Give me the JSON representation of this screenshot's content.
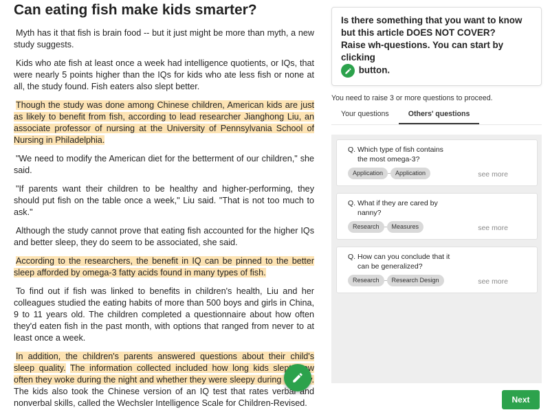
{
  "article": {
    "title": "Can eating fish make kids smarter?",
    "paragraphs": [
      {
        "segments": [
          {
            "text": "Myth has it that fish is brain food -- but it just might be more than myth, a new study suggests.",
            "hl": false
          }
        ]
      },
      {
        "segments": [
          {
            "text": "Kids who ate fish at least once a week had intelligence quotients, or IQs, that were nearly 5 points higher than the IQs for kids who ate less fish or none at all, the study found. Fish eaters also slept better.",
            "hl": false
          }
        ]
      },
      {
        "segments": [
          {
            "text": "Though the study was done among Chinese children, American kids are just as likely to benefit from fish, according to lead researcher Jianghong Liu, an associate professor of nursing at the University of Pennsylvania School of Nursing in Philadelphia.",
            "hl": true
          }
        ]
      },
      {
        "segments": [
          {
            "text": "\"We need to modify the American diet for the betterment of our children,\" she said.",
            "hl": false
          }
        ]
      },
      {
        "segments": [
          {
            "text": "\"If parents want their children to be healthy and higher-performing, they should put fish on the table once a week,\" Liu said.  \"That is not too much to ask.\"",
            "hl": false
          }
        ]
      },
      {
        "segments": [
          {
            "text": "Although the study cannot prove that eating fish accounted for the higher IQs and better sleep, they do seem to be associated, she said.",
            "hl": false
          }
        ]
      },
      {
        "segments": [
          {
            "text": "According to the researchers, the benefit in IQ can be pinned to the better sleep afforded by omega-3 fatty acids found in many types of fish.",
            "hl": true
          }
        ]
      },
      {
        "segments": [
          {
            "text": "To find out if fish was linked to benefits in children's health, Liu and her colleagues studied the eating habits of more than 500 boys and girls in China, 9 to 11 years old.  The children completed a questionnaire about how often they'd eaten fish in the past month, with options that ranged from never to at least once a week.",
            "hl": false
          }
        ]
      },
      {
        "segments": [
          {
            "text": "In addition, the children's parents answered questions about their child's sleep quality.",
            "hl": true
          },
          {
            "text": " ",
            "hl": false
          },
          {
            "text": "The information collected included how long kids slept, how often they woke during the night and whether they were sleepy during the day.",
            "hl": true
          },
          {
            "text": " The kids also took the Chinese version of an IQ test that rates verbal and nonverbal skills, called the Wechsler Intelligence Scale for Children-Revised.",
            "hl": false
          }
        ]
      }
    ]
  },
  "prompt": {
    "line1": "Is there something that you want to know but this article DOES NOT COVER?",
    "line2": "Raise wh-questions. You can start by clicking",
    "line3": "button."
  },
  "requirement": "You need to raise 3 or more questions to proceed.",
  "tabs": [
    "Your questions",
    "Others' questions"
  ],
  "active_tab": 1,
  "questions": [
    {
      "prefix": "Q.",
      "line1": "Which type of fish contains",
      "line2": "the most omega-3?",
      "tags": [
        "Application",
        "Application"
      ],
      "see_more": "see more"
    },
    {
      "prefix": "Q.",
      "line1": "What if they are cared by",
      "line2": "nanny?",
      "tags": [
        "Research",
        "Measures"
      ],
      "see_more": "see more"
    },
    {
      "prefix": "Q.",
      "line1": "How can you conclude that it",
      "line2": "can be generalized?",
      "tags": [
        "Research",
        "Research Design"
      ],
      "see_more": "see more"
    }
  ],
  "next_label": "Next",
  "icons": {
    "pen": "pen-icon"
  },
  "colors": {
    "accent": "#2ca24c",
    "highlight": "#fde3b3",
    "panel": "#eeeeee"
  }
}
